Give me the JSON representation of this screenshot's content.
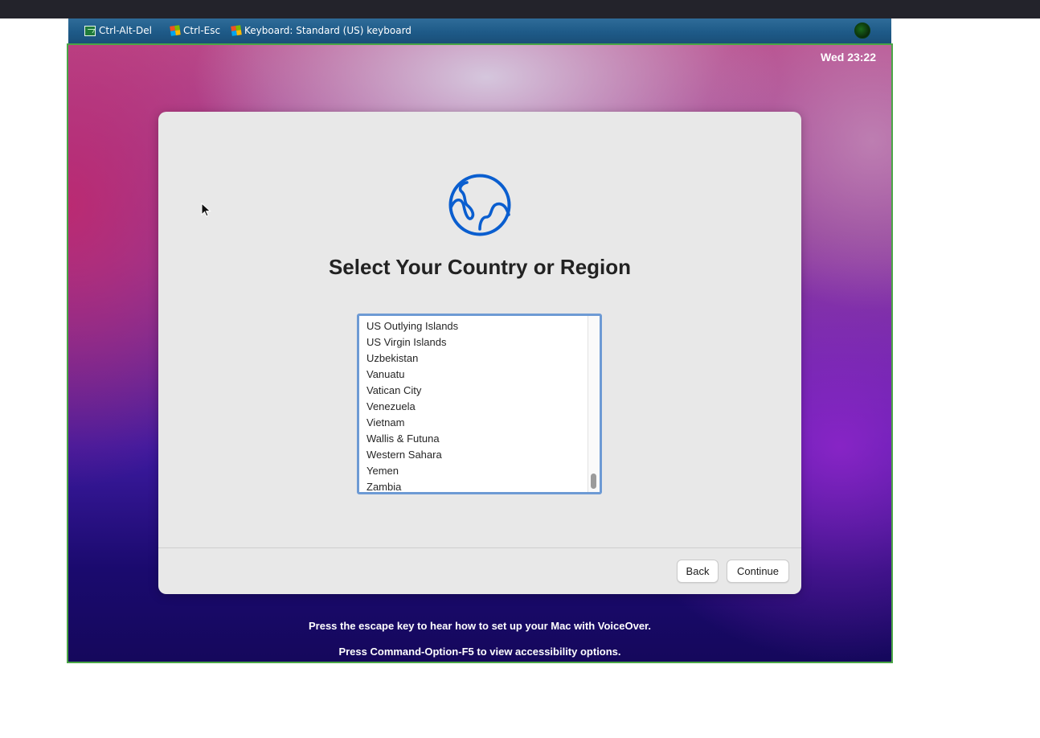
{
  "vm_toolbar": {
    "items": [
      {
        "label": "Ctrl-Alt-Del",
        "icon": "monitor-icon"
      },
      {
        "label": "Ctrl-Esc",
        "icon": "windows-logo-icon"
      },
      {
        "label": "Keyboard: Standard (US) keyboard",
        "icon": "windows-logo-icon"
      }
    ]
  },
  "menubar": {
    "clock": "Wed 23:22"
  },
  "setup": {
    "icon": "globe-icon",
    "title": "Select Your Country or Region",
    "countries": [
      "US Outlying Islands",
      "US Virgin Islands",
      "Uzbekistan",
      "Vanuatu",
      "Vatican City",
      "Venezuela",
      "Vietnam",
      "Wallis & Futuna",
      "Western Sahara",
      "Yemen",
      "Zambia"
    ],
    "back_label": "Back",
    "continue_label": "Continue"
  },
  "footer": {
    "hint_voiceover": "Press the escape key to hear how to set up your Mac with VoiceOver.",
    "hint_accessibility": "Press Command-Option-F5 to view accessibility options."
  },
  "colors": {
    "accent": "#0a5ecf",
    "listbox_focus": "#6d9ad4",
    "vm_border": "#4aa546"
  }
}
